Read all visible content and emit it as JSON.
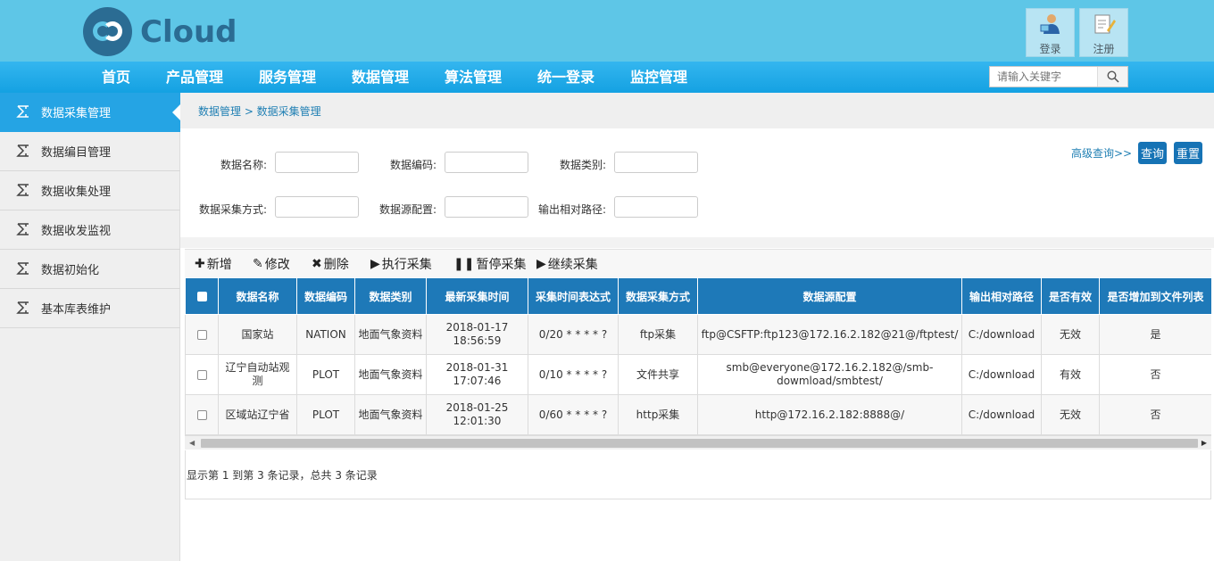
{
  "header": {
    "logo_text": "Cloud",
    "login_label": "登录",
    "register_label": "注册"
  },
  "nav": {
    "items": [
      "首页",
      "产品管理",
      "服务管理",
      "数据管理",
      "算法管理",
      "统一登录",
      "监控管理"
    ],
    "search_placeholder": "请输入关键字"
  },
  "sidebar": {
    "items": [
      {
        "label": "数据采集管理",
        "active": true
      },
      {
        "label": "数据编目管理"
      },
      {
        "label": "数据收集处理"
      },
      {
        "label": "数据收发监视"
      },
      {
        "label": "数据初始化"
      },
      {
        "label": "基本库表维护"
      }
    ]
  },
  "breadcrumb": "数据管理 > 数据采集管理",
  "filter": {
    "name_label": "数据名称:",
    "code_label": "数据编码:",
    "type_label": "数据类别:",
    "method_label": "数据采集方式:",
    "source_label": "数据源配置:",
    "path_label": "输出相对路径:",
    "advanced_label": "高级查询>>",
    "query_label": "查询",
    "reset_label": "重置"
  },
  "toolbar": {
    "add": "新增",
    "edit": "修改",
    "delete": "删除",
    "run": "执行采集",
    "pause": "暂停采集",
    "resume": "继续采集"
  },
  "table": {
    "headers": [
      "数据名称",
      "数据编码",
      "数据类别",
      "最新采集时间",
      "采集时间表达式",
      "数据采集方式",
      "数据源配置",
      "输出相对路径",
      "是否有效",
      "是否增加到文件列表"
    ],
    "rows": [
      [
        "国家站",
        "NATION",
        "地面气象资料",
        "2018-01-17 18:56:59",
        "0/20 * * * * ?",
        "ftp采集",
        "ftp@CSFTP:ftp123@172.16.2.182@21@/ftptest/",
        "C:/download",
        "无效",
        "是"
      ],
      [
        "辽宁自动站观测",
        "PLOT",
        "地面气象资料",
        "2018-01-31 17:07:46",
        "0/10 * * * * ?",
        "文件共享",
        "smb@everyone@172.16.2.182@/smb-dowmload/smbtest/",
        "C:/download",
        "有效",
        "否"
      ],
      [
        "区域站辽宁省",
        "PLOT",
        "地面气象资料",
        "2018-01-25 12:01:30",
        "0/60 * * * * ?",
        "http采集",
        "http@172.16.2.182:8888@/",
        "C:/download",
        "无效",
        "否"
      ]
    ]
  },
  "footer": "显示第 1 到第 3 条记录，总共 3 条记录",
  "colors": {
    "header_bg": "#5ec6e7",
    "nav_bg": "#14a1e2",
    "active_side": "#25a4e4",
    "table_head": "#1e79b8"
  }
}
